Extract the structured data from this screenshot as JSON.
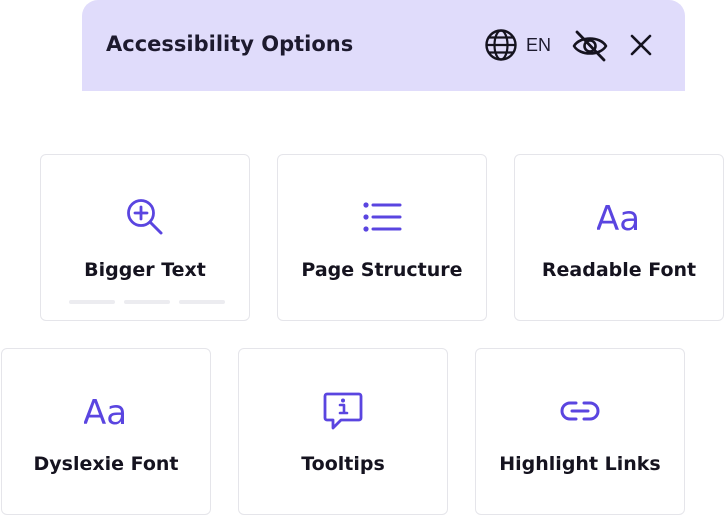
{
  "header": {
    "title": "Accessibility Options",
    "language": "EN",
    "icons": {
      "language": "globe-icon",
      "hide": "eye-off-icon",
      "close": "close-icon"
    }
  },
  "colors": {
    "accent": "#5a45e0",
    "header_bg": "#e0dcfb",
    "card_border": "#e5e5ea",
    "text": "#15131f"
  },
  "cards": [
    {
      "label": "Bigger Text",
      "icon": "zoom-in-icon",
      "level": 0,
      "levels": 3
    },
    {
      "label": "Page Structure",
      "icon": "list-icon"
    },
    {
      "label": "Readable Font",
      "icon": "font-aa-icon",
      "glyph": "Aa"
    },
    {
      "label": "Dyslexie Font",
      "icon": "font-aa-icon",
      "glyph": "Aa"
    },
    {
      "label": "Tooltips",
      "icon": "tooltip-info-icon"
    },
    {
      "label": "Highlight Links",
      "icon": "link-icon"
    }
  ]
}
